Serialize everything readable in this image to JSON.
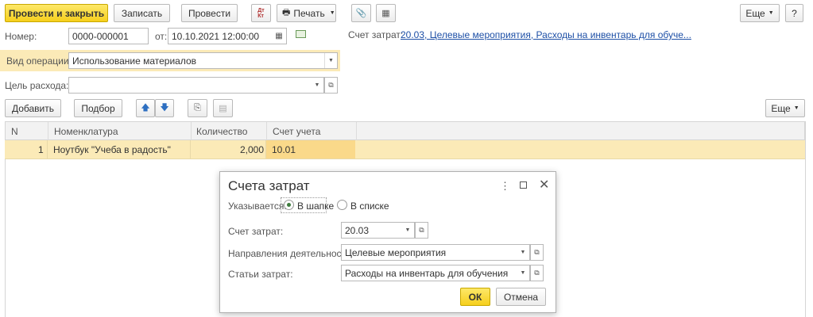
{
  "toolbar": {
    "post_close": "Провести и закрыть",
    "save": "Записать",
    "post": "Провести",
    "print": "Печать",
    "more": "Еще",
    "help": "?"
  },
  "header": {
    "number_label": "Номер:",
    "number_value": "0000-000001",
    "date_label": "от:",
    "date_value": "10.10.2021 12:00:00",
    "cost_account_label": "Счет затрат:",
    "cost_account_link": "20.03, Целевые мероприятия, Расходы на инвентарь для обуче...",
    "operation_label": "Вид операции:",
    "operation_value": "Использование материалов",
    "purpose_label": "Цель расхода:",
    "purpose_value": ""
  },
  "table_toolbar": {
    "add": "Добавить",
    "pick": "Подбор",
    "more": "Еще"
  },
  "table": {
    "columns": [
      "N",
      "Номенклатура",
      "Количество",
      "Счет учета"
    ],
    "rows": [
      {
        "n": "1",
        "item": "Ноутбук \"Учеба в радость\"",
        "qty": "2,000",
        "account": "10.01"
      }
    ]
  },
  "dialog": {
    "title": "Счета затрат",
    "specified_label": "Указывается:",
    "option_header": "В шапке",
    "option_list": "В списке",
    "selected_option": "header",
    "cost_account_label": "Счет затрат:",
    "cost_account_value": "20.03",
    "direction_label": "Направления деятельности:",
    "direction_value": "Целевые мероприятия",
    "items_label": "Статьи затрат:",
    "items_value": "Расходы на инвентарь для обучения",
    "ok": "ОК",
    "cancel": "Отмена"
  },
  "colors": {
    "primary_button": "#f6cf1d",
    "selected_row": "#fbeab7",
    "link": "#1d4fa6",
    "operation_highlight": "#fbeab7"
  }
}
